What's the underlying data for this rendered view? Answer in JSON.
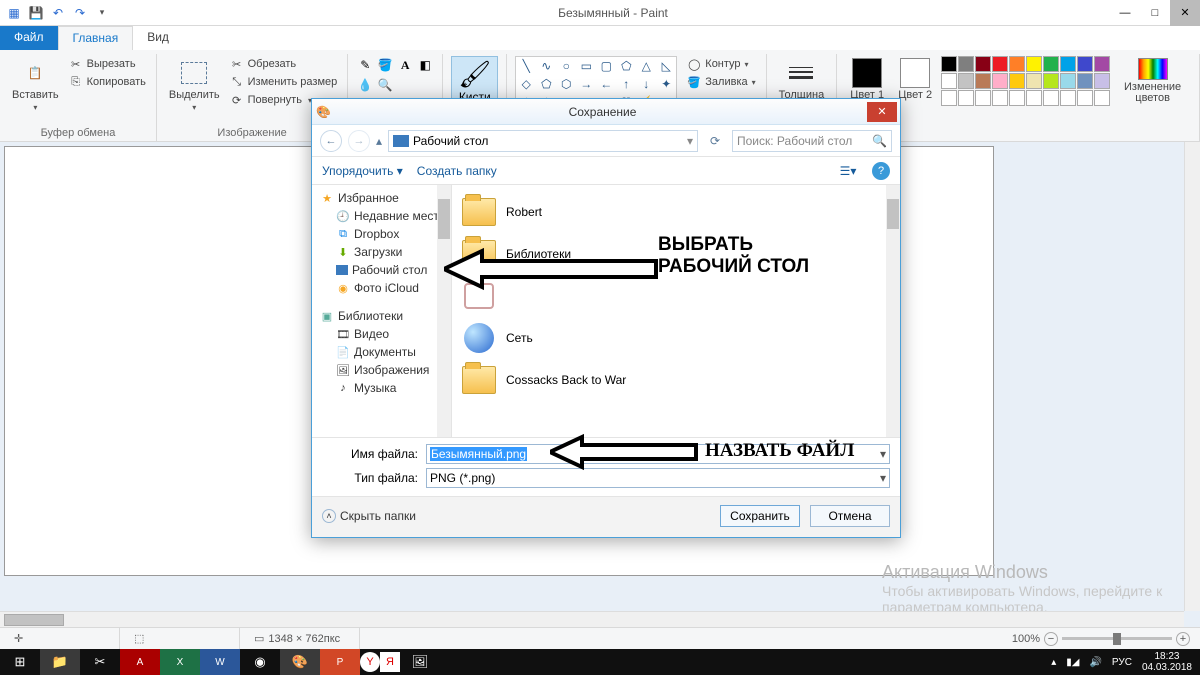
{
  "window": {
    "title": "Безымянный - Paint",
    "qat": {
      "save": "💾",
      "undo": "↶",
      "redo": "↷"
    }
  },
  "tabs": {
    "file": "Файл",
    "home": "Главная",
    "view": "Вид"
  },
  "ribbon": {
    "clipboard": {
      "paste": "Вставить",
      "cut": "Вырезать",
      "copy": "Копировать",
      "group": "Буфер обмена"
    },
    "image": {
      "select": "Выделить",
      "crop": "Обрезать",
      "resize": "Изменить размер",
      "rotate": "Повернуть",
      "group": "Изображение"
    },
    "tools": {
      "group": ""
    },
    "brushes": {
      "label": "Кисти"
    },
    "shapes": {
      "outline": "Контур",
      "fill": "Заливка"
    },
    "thickness": "Толщина",
    "color1": "Цвет 1",
    "color2": "Цвет 2",
    "editcolors": "Изменение цветов"
  },
  "dialog": {
    "title": "Сохранение",
    "location": "Рабочий стол",
    "search_ph": "Поиск: Рабочий стол",
    "organize": "Упорядочить",
    "newfolder": "Создать папку",
    "tree": {
      "favorites": "Избранное",
      "fav_items": [
        "Недавние места",
        "Dropbox",
        "Загрузки",
        "Рабочий стол",
        "Фото iCloud"
      ],
      "libraries": "Библиотеки",
      "lib_items": [
        "Видео",
        "Документы",
        "Изображения",
        "Музыка"
      ]
    },
    "files": [
      "Robert",
      "Библиотеки",
      "",
      "Сеть",
      "Cossacks Back to War"
    ],
    "filename_label": "Имя файла:",
    "filename_value": "Безымянный.png",
    "filetype_label": "Тип файла:",
    "filetype_value": "PNG (*.png)",
    "hide": "Скрыть папки",
    "save": "Сохранить",
    "cancel": "Отмена"
  },
  "annotations": {
    "a1_l1": "ВЫБРАТЬ",
    "a1_l2": "РАБОЧИЙ СТОЛ",
    "a2": "НАЗВАТЬ ФАЙЛ"
  },
  "watermark": {
    "title": "Активация Windows",
    "sub": "Чтобы активировать Windows, перейдите к параметрам компьютера."
  },
  "status": {
    "pos_icon": "✛",
    "size_icon": "⣏",
    "dims": "1348 × 762пкс",
    "zoom": "100%"
  },
  "taskbar": {
    "lang": "РУС",
    "time": "18:23",
    "date": "04.03.2018"
  },
  "palette_colors": [
    "#000",
    "#7f7f7f",
    "#880015",
    "#ed1c24",
    "#ff7f27",
    "#fff200",
    "#22b14c",
    "#00a2e8",
    "#3f48cc",
    "#a349a4",
    "#fff",
    "#c3c3c3",
    "#b97a57",
    "#ffaec9",
    "#ffc90e",
    "#efe4b0",
    "#b5e61d",
    "#99d9ea",
    "#7092be",
    "#c8bfe7",
    "#fff",
    "#fff",
    "#fff",
    "#fff",
    "#fff",
    "#fff",
    "#fff",
    "#fff",
    "#fff",
    "#fff"
  ]
}
